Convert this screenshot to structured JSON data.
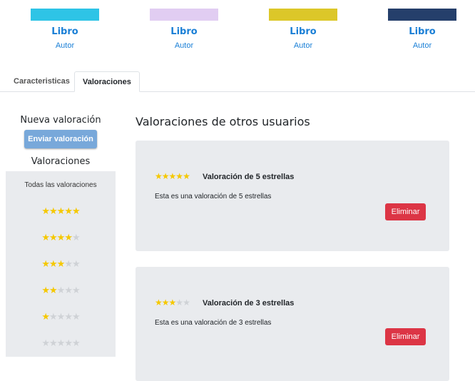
{
  "books": [
    {
      "title": "Libro",
      "author": "Autor",
      "color": "#2ec4e6"
    },
    {
      "title": "Libro",
      "author": "Autor",
      "color": "#e1cdf2"
    },
    {
      "title": "Libro",
      "author": "Autor",
      "color": "#dcc729"
    },
    {
      "title": "Libro",
      "author": "Autor",
      "color": "#253f6b"
    }
  ],
  "tabs": [
    {
      "label": "Caracteristicas",
      "active": false
    },
    {
      "label": "Valoraciones",
      "active": true
    }
  ],
  "sidebar": {
    "new_rating_heading": "Nueva valoración",
    "send_button": "Enviar valoración",
    "ratings_heading": "Valoraciones",
    "all_ratings": "Todas las valoraciones",
    "filters": [
      {
        "stars": 5
      },
      {
        "stars": 4
      },
      {
        "stars": 3
      },
      {
        "stars": 2
      },
      {
        "stars": 1
      },
      {
        "stars": 0
      }
    ]
  },
  "main": {
    "title": "Valoraciones de otros usuarios",
    "reviews": [
      {
        "stars": 5,
        "title": "Valoración de 5 estrellas",
        "text": "Esta es una valoración de 5 estrellas",
        "delete_label": "Eliminar"
      },
      {
        "stars": 3,
        "title": "Valoración de 3 estrellas",
        "text": "Esta es una valoración de 3 estrellas",
        "delete_label": "Eliminar"
      }
    ]
  },
  "colors": {
    "star_on": "#f5c800",
    "star_off": "#cfd2d6",
    "link": "#1a7fd6",
    "danger": "#dc3545",
    "primary_muted": "#78a8da"
  }
}
